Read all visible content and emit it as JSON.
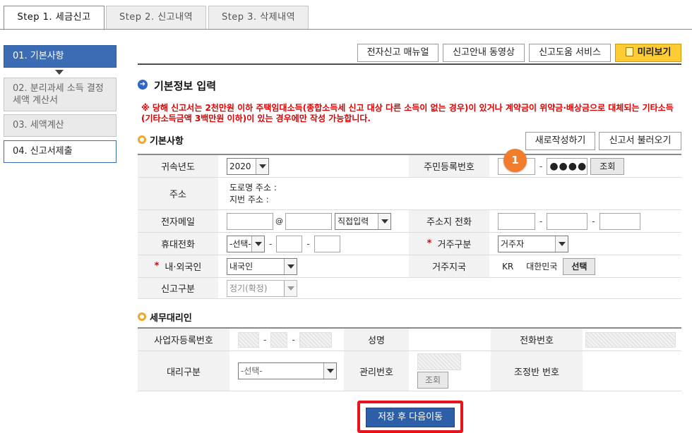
{
  "tabs": [
    "Step 1. 세금신고",
    "Step 2. 신고내역",
    "Step 3. 삭제내역"
  ],
  "side_nav": [
    {
      "label": "01. 기본사항"
    },
    {
      "label": "02. 분리과세 소득 결정세액 계산서"
    },
    {
      "label": "03. 세액계산"
    },
    {
      "label": "04. 신고서제출"
    }
  ],
  "top_buttons": {
    "manual": "전자신고 매뉴얼",
    "video": "신고안내 동영상",
    "help": "신고도움 서비스",
    "preview": "미리보기"
  },
  "section_title": "기본정보 입력",
  "notice": "※ 당해 신고서는 2천만원 이하 주택임대소득(종합소득세 신고 대상 다른 소득이 없는 경우)이 있거나 계약금이 위약금·배상금으로 대체되는 기타소득(기타소득금액 3백만원 이하)이 있는 경우에만 작성 가능합니다.",
  "basic": {
    "title": "기본사항",
    "new_button": "새로작성하기",
    "load_button": "신고서 불러오기",
    "labels": {
      "year": "귀속년도",
      "rrn": "주민등록번호",
      "address": "주소",
      "email": "전자메일",
      "home_phone": "주소지 전화",
      "mobile": "휴대전화",
      "residence_type": "거주구분",
      "nationality": "내·외국인",
      "residence_country": "거주지국",
      "report_type": "신고구분"
    },
    "year_value": "2020",
    "rrn_masked": "●●●●",
    "lookup_button": "조회",
    "badge": "1",
    "road_address": "도로명 주소 :",
    "lot_address": "지번 주소 :",
    "email_at": "@",
    "email_domain_select": "직접입력",
    "mobile_select": "-선택-",
    "residence_type_value": "거주자",
    "nationality_value": "내국인",
    "country_code": "KR",
    "country_name": "대한민국",
    "select_button": "선택",
    "report_type_value": "정기(확정)",
    "dash": "-"
  },
  "agent": {
    "title": "세무대리인",
    "labels": {
      "biz_no": "사업자등록번호",
      "name": "성명",
      "phone": "전화번호",
      "type": "대리구분",
      "mgmt_no": "관리번호",
      "team_no": "조정반 번호"
    },
    "type_select": "-선택-",
    "lookup_button": "조회"
  },
  "save_button": "저장 후 다음이동",
  "colors": {
    "nav_active": "#3b6cb4",
    "notice_red": "#e00000",
    "preview_yellow": "#ffcc33",
    "save_blue": "#2d5fa8",
    "highlight_red": "#e8141c",
    "badge_orange": "#f07c2c"
  }
}
